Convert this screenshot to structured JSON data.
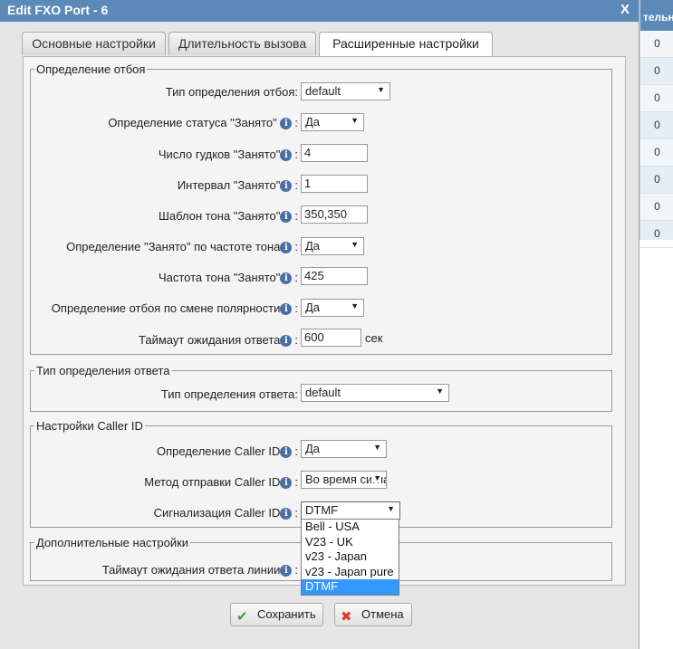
{
  "background_table": {
    "header": "тельн",
    "cells": [
      "0",
      "0",
      "0",
      "0",
      "0",
      "0",
      "0",
      "0"
    ]
  },
  "dialog": {
    "title": "Edit FXO Port - 6",
    "close_label": "X"
  },
  "tabs": [
    {
      "label": "Основные настройки"
    },
    {
      "label": "Длительность вызова"
    },
    {
      "label": "Расширенные настройки",
      "active": true
    }
  ],
  "hangup": {
    "legend": "Определение отбоя",
    "type_label": "Тип определения отбоя:",
    "type_value": "default",
    "busy_status_label": "Определение статуса \"Занято\"",
    "busy_status_value": "Да",
    "busy_count_label": "Число гудков \"Занято\"",
    "busy_count_value": "4",
    "busy_interval_label": "Интервал \"Занято\"",
    "busy_interval_value": "1",
    "busy_pattern_label": "Шаблон тона \"Занято\"",
    "busy_pattern_value": "350,350",
    "busy_freq_detect_label": "Определение \"Занято\" по частоте тона",
    "busy_freq_detect_value": "Да",
    "busy_freq_label": "Частота тона \"Занято\"",
    "busy_freq_value": "425",
    "polarity_label": "Определение отбоя по смене полярности",
    "polarity_value": "Да",
    "answer_timeout_label": "Таймаут ожидания ответа",
    "answer_timeout_value": "600",
    "answer_timeout_unit": "сек"
  },
  "answer": {
    "legend": "Тип определения ответа",
    "type_label": "Тип определения ответа:",
    "type_value": "default"
  },
  "callerid": {
    "legend": "Настройки Caller ID",
    "detect_label": "Определение Caller ID",
    "detect_value": "Да",
    "method_label": "Метод отправки Caller ID",
    "method_value": "Во время сигнала",
    "signaling_label": "Сигнализация Caller ID",
    "signaling_value": "DTMF",
    "signaling_options": [
      "Bell - USA",
      "V23 - UK",
      "v23 - Japan",
      "v23 - Japan pure",
      "DTMF"
    ]
  },
  "extra": {
    "legend": "Дополнительные настройки",
    "line_timeout_label": "Таймаут ожидания ответа линии"
  },
  "buttons": {
    "save": "Сохранить",
    "cancel": "Отмена"
  },
  "colors": {
    "titlebar": "#5c8ab8",
    "highlight": "#3399ff",
    "info_icon": "#4a6fa5"
  }
}
